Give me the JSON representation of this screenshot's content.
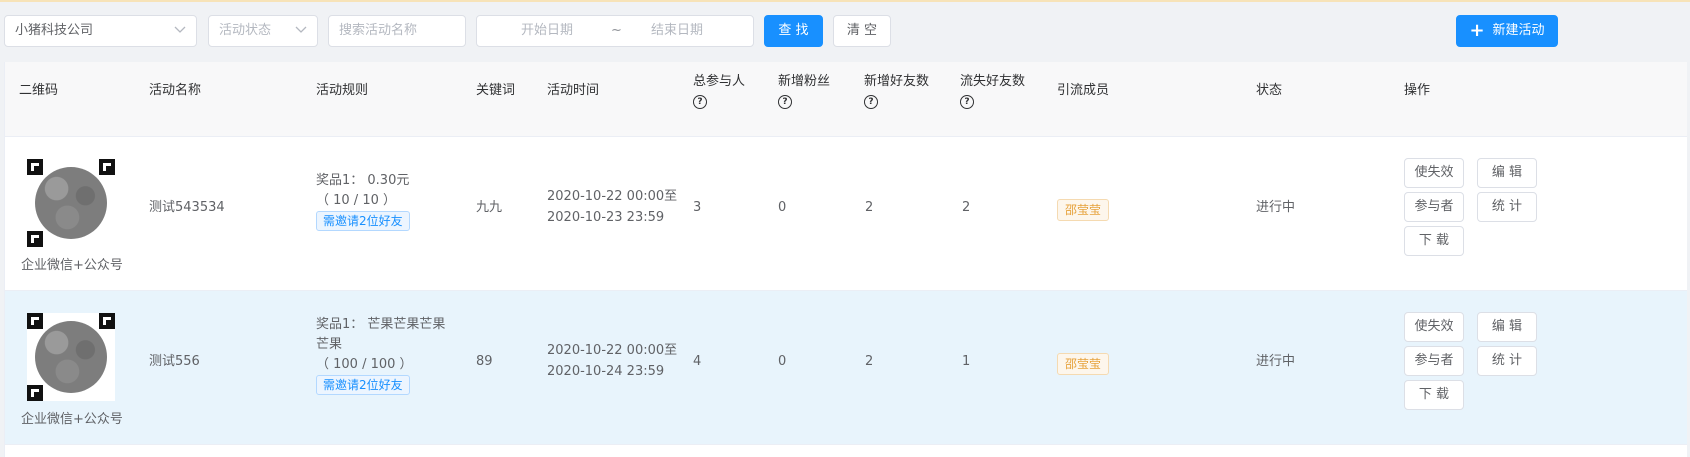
{
  "filters": {
    "company_value": "小猪科技公司",
    "status_placeholder": "活动状态",
    "name_placeholder": "搜索活动名称",
    "start_date_placeholder": "开始日期",
    "date_separator": "~",
    "end_date_placeholder": "结束日期",
    "search_label": "查 找",
    "clear_label": "清 空",
    "new_label": "新建活动"
  },
  "table": {
    "headers": {
      "qrcode": "二维码",
      "name": "活动名称",
      "rule": "活动规则",
      "keyword": "关键词",
      "time": "活动时间",
      "total": "总参与人",
      "new_fans": "新增粉丝",
      "new_friends": "新增好友数",
      "lost_friends": "流失好友数",
      "member": "引流成员",
      "status": "状态",
      "action": "操作"
    },
    "help_glyph": "?",
    "rows": [
      {
        "qr_caption": "企业微信+公众号",
        "name": "测试543534",
        "rule_line1": "奖品1： 0.30元",
        "rule_line2": "（ 10 / 10 ）",
        "rule_tag": "需邀请2位好友",
        "keyword": "九九",
        "time_start": "2020-10-22 00:00至",
        "time_end": "2020-10-23 23:59",
        "total": "3",
        "new_fans": "0",
        "new_friends": "2",
        "lost_friends": "2",
        "member": "邵莹莹",
        "status": "进行中"
      },
      {
        "qr_caption": "企业微信+公众号",
        "name": "测试556",
        "rule_line1": "奖品1： 芒果芒果芒果",
        "rule_line1b": "芒果",
        "rule_line2": "（ 100 / 100 ）",
        "rule_tag": "需邀请2位好友",
        "keyword": "89",
        "time_start": "2020-10-22 00:00至",
        "time_end": "2020-10-24 23:59",
        "total": "4",
        "new_fans": "0",
        "new_friends": "2",
        "lost_friends": "1",
        "member": "邵莹莹",
        "status": "进行中"
      }
    ],
    "actions": {
      "invalidate": "使失效",
      "edit": "编 辑",
      "participants": "参与者",
      "stats": "统 计",
      "download": "下 载"
    }
  },
  "colors": {
    "primary": "#1890ff",
    "highlight_row": "#e8f4fc",
    "member_tag": "#e6a23c"
  }
}
